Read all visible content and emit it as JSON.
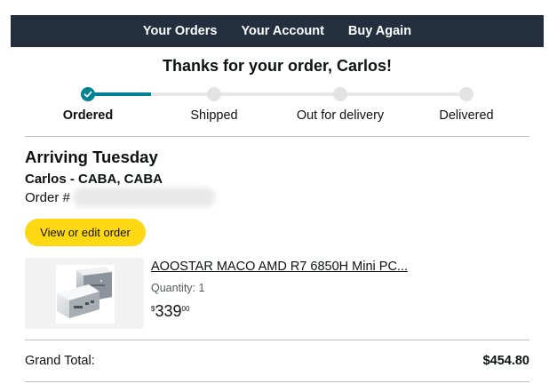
{
  "nav": {
    "items": [
      "Your Orders",
      "Your Account",
      "Buy Again"
    ]
  },
  "header": {
    "title": "Thanks for your order, Carlos!"
  },
  "progress": {
    "current_step": 0,
    "steps": [
      "Ordered",
      "Shipped",
      "Out for delivery",
      "Delivered"
    ]
  },
  "delivery": {
    "arriving": "Arriving Tuesday",
    "address": "Carlos - CABA, CABA",
    "order_label": "Order #"
  },
  "actions": {
    "view_edit": "View or edit order"
  },
  "product": {
    "title": "AOOSTAR MACO AMD R7 6850H Mini PC...",
    "quantity": "Quantity: 1",
    "price_symbol": "$",
    "price_whole": "339",
    "price_fraction": "00"
  },
  "totals": {
    "label": "Grand Total:",
    "value": "$454.80"
  },
  "colors": {
    "nav_bg": "#232f3e",
    "accent": "#008296",
    "button": "#ffd814"
  }
}
